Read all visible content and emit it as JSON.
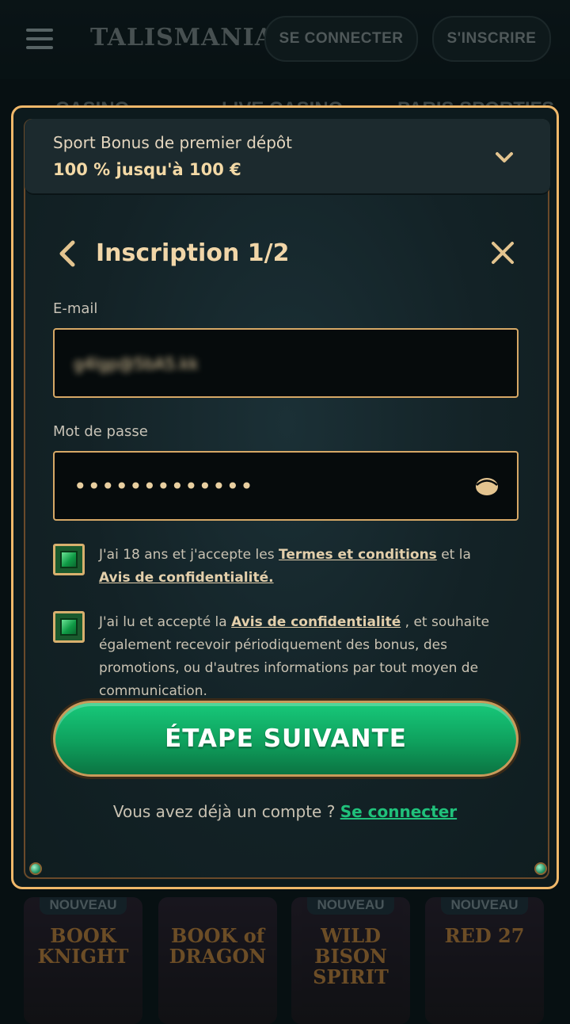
{
  "header": {
    "logo": "TALISMANIA",
    "login_label": "SE CONNECTER",
    "signup_label": "S'INSCRIRE"
  },
  "nav": {
    "items": [
      "CASINO",
      "LIVE CASINO",
      "PARIS SPORTIFS"
    ]
  },
  "games": [
    {
      "badge": "NOUVEAU",
      "title": "BOOK KNIGHT"
    },
    {
      "badge": "",
      "title": "BOOK of DRAGON"
    },
    {
      "badge": "NOUVEAU",
      "title": "WILD BISON SPIRIT"
    },
    {
      "badge": "NOUVEAU",
      "title": "RED 27"
    }
  ],
  "modal": {
    "bonus": {
      "subtitle": "Sport Bonus de premier dépôt",
      "amount": "100 % jusqu'à 100 €"
    },
    "title": "Inscription 1/2",
    "email_label": "E-mail",
    "email_value": "g4lgp@5bA5.kk",
    "password_label": "Mot de passe",
    "password_mask": "•••••••••••••",
    "consent1": {
      "text_before": "J'ai 18 ans et j'accepte les ",
      "link1": "Termes et conditions",
      "text_mid": " et la ",
      "link2": "Avis de confidentialité."
    },
    "consent2": {
      "text_before": "J'ai lu et accepté la ",
      "link": "Avis de confidentialité",
      "text_after": " , et souhaite également recevoir périodiquement des bonus, des promotions, ou d'autres informations par tout moyen de communication."
    },
    "cta_label": "ÉTAPE SUIVANTE",
    "login_prompt": "Vous avez déjà un compte ? ",
    "login_link": "Se connecter"
  }
}
